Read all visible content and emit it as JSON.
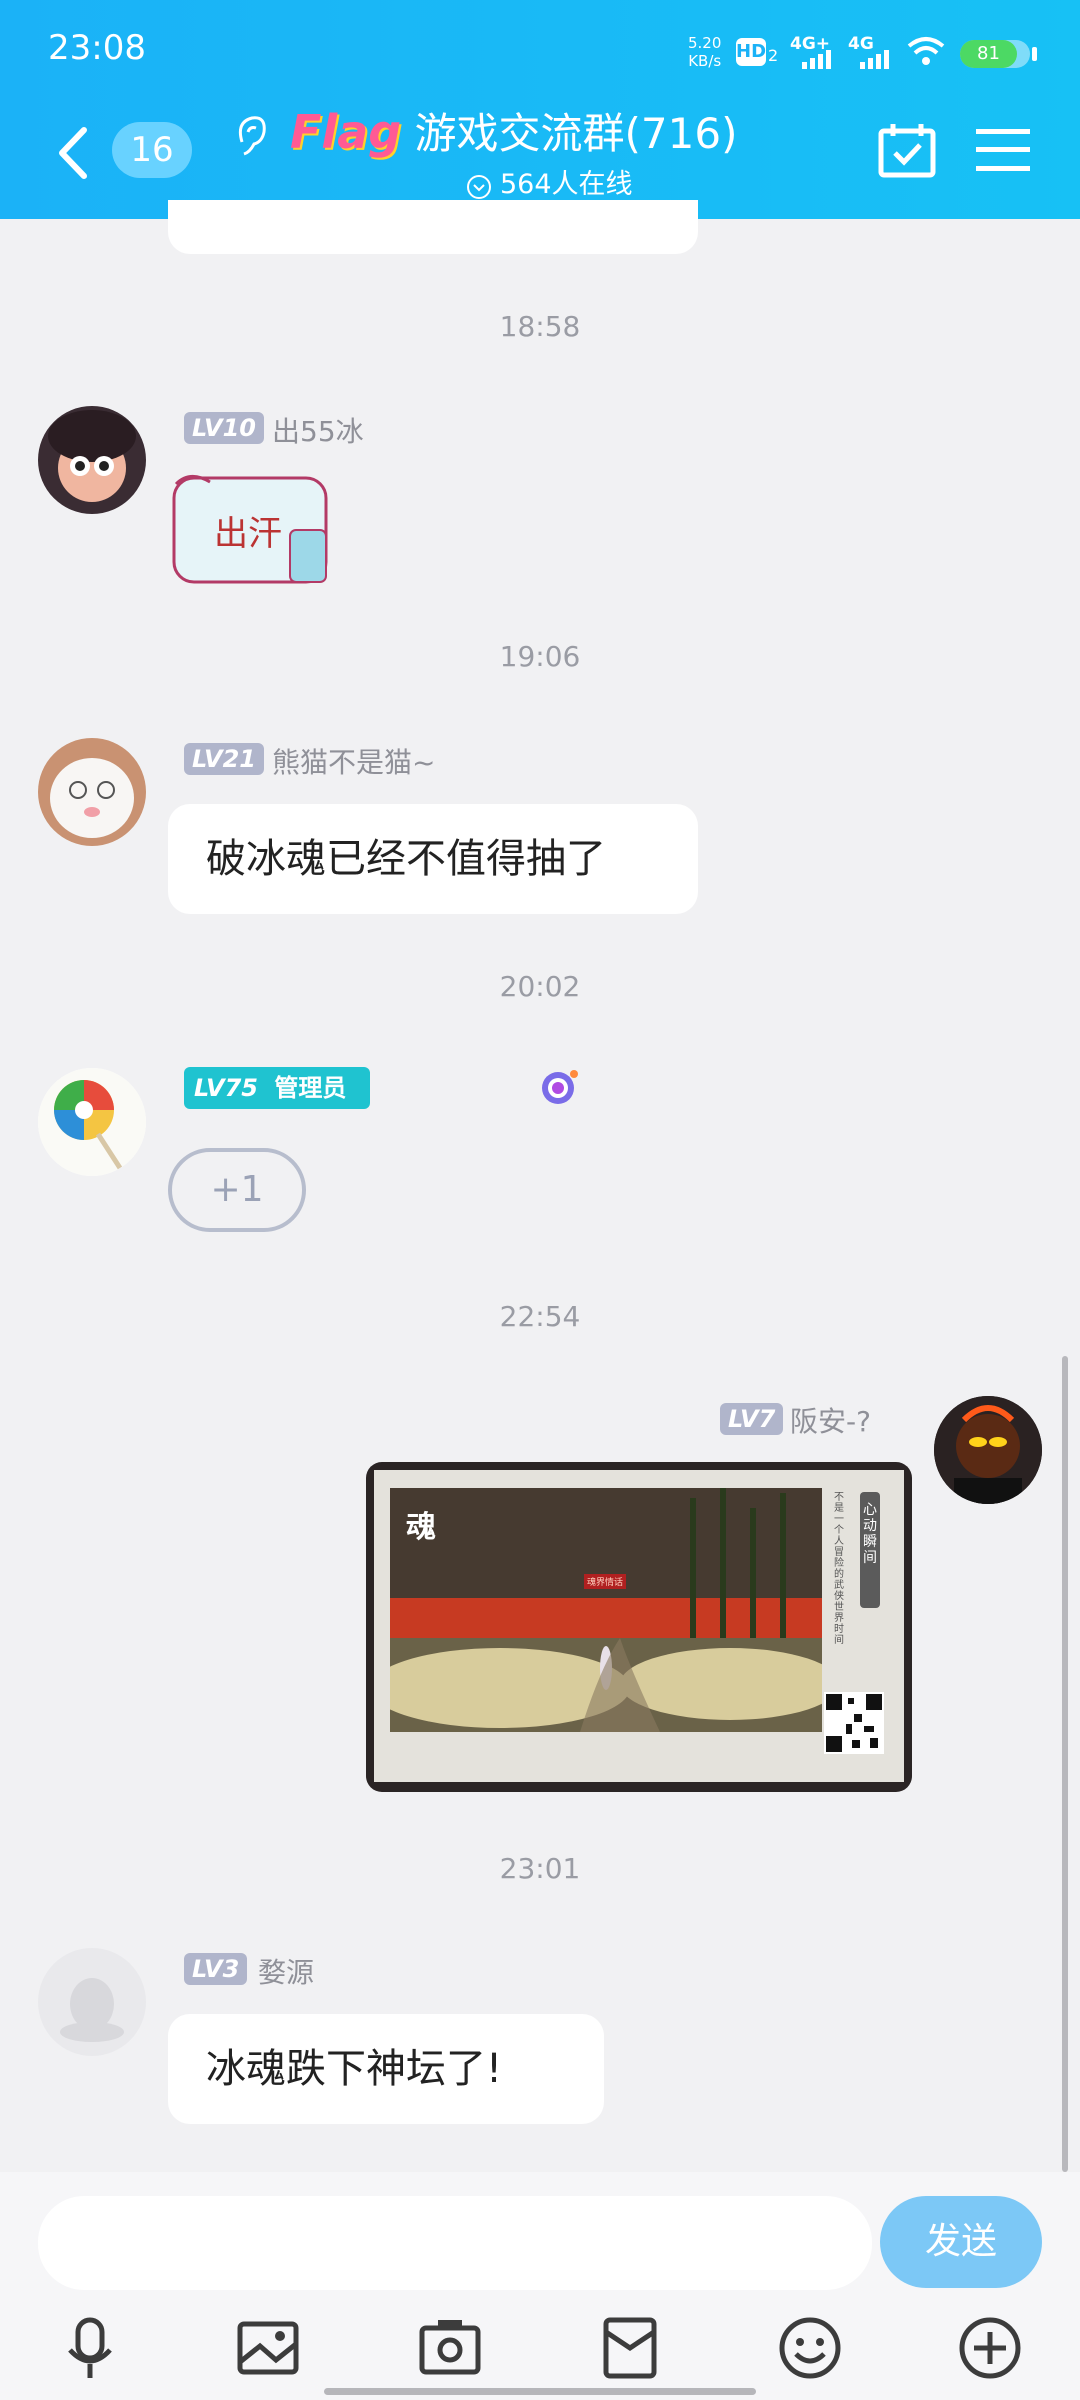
{
  "status_bar": {
    "time": "23:08",
    "net_speed_value": "5.20",
    "net_speed_unit": "KB/s",
    "hd": "HD",
    "hd_sub": "2",
    "sig1": "4G+",
    "sig2": "4G",
    "battery": "81"
  },
  "header": {
    "badge_count": "16",
    "flag_text": "Flag",
    "title": "游戏交流群(716)",
    "subtitle": "564人在线"
  },
  "messages": [
    {
      "time": "18:58",
      "level": "LV10",
      "name": "出55冰",
      "sticker_text": "出汗"
    },
    {
      "time": "19:06",
      "level": "LV21",
      "name": "熊猫不是猫~",
      "text": "破冰魂已经不值得抽了"
    },
    {
      "time": "20:02",
      "level": "LV75",
      "role": "管理员",
      "sticker_text": "+1"
    },
    {
      "time": "22:54",
      "level": "LV7",
      "name": "阪安-?"
    },
    {
      "time": "23:01",
      "level": "LV3",
      "name": "婺源",
      "text": "冰魂跌下神坛了!"
    }
  ],
  "shared_image": {
    "logo_char": "魂",
    "tag": "心动瞬间",
    "caption": "不是一个人冒险的武侠世界时间",
    "banner": "魂界情话"
  },
  "input": {
    "placeholder": "",
    "send_label": "发送"
  },
  "toolbar": [
    "microphone-icon",
    "image-icon",
    "camera-icon",
    "red-packet-icon",
    "emoji-icon",
    "plus-icon"
  ],
  "colors": {
    "header": "#17b8f6",
    "admin_badge": "#1fc3d0",
    "send_button": "#7cc8f6",
    "level_badge": "#b0b5cb"
  }
}
